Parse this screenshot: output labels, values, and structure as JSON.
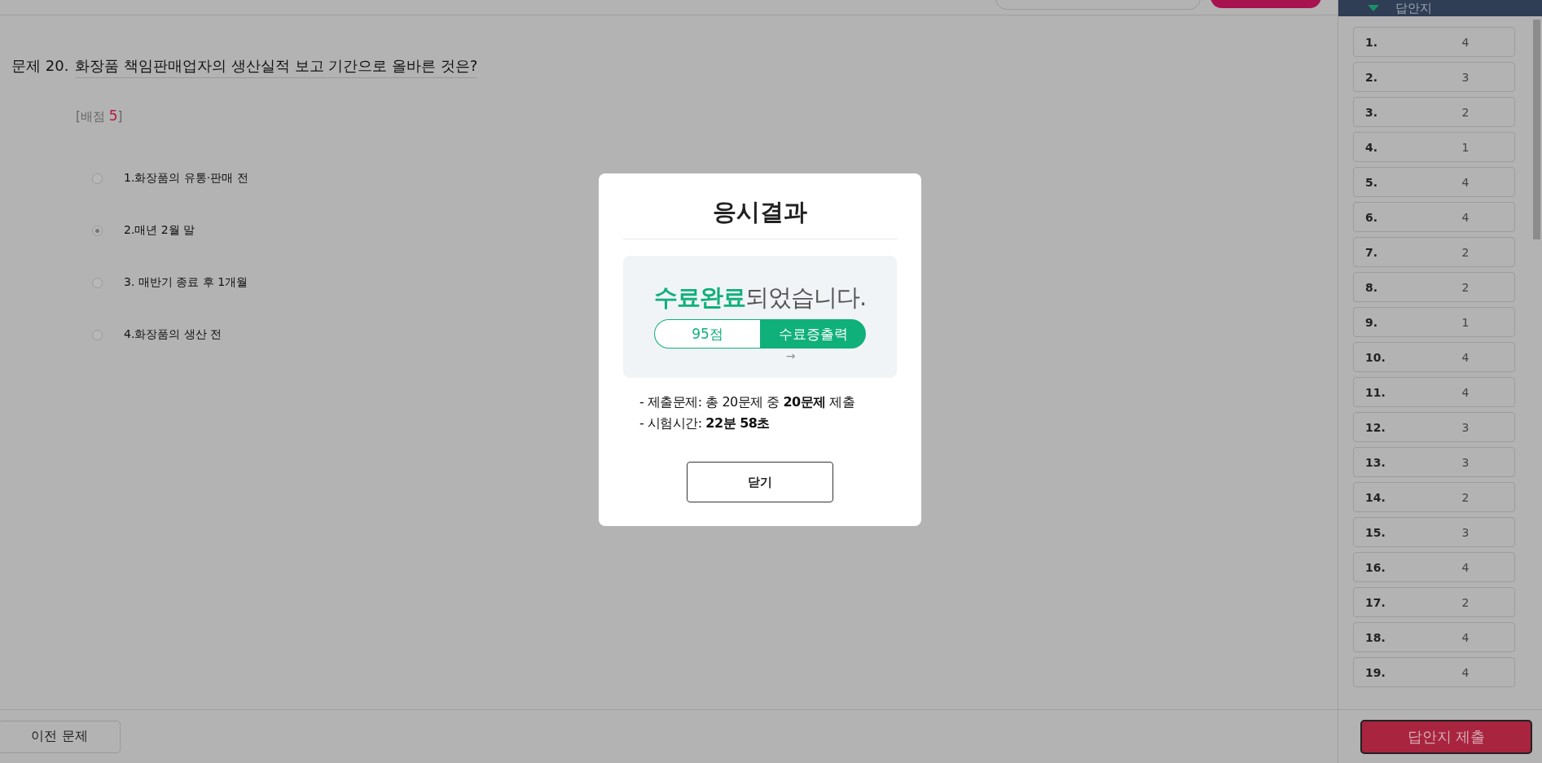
{
  "question": {
    "number": "문제 20.",
    "text": "화장품 책임판매업자의 생산실적 보고 기간으로 올바른 것은?",
    "score_prefix": "[배점",
    "score": "5",
    "score_suffix": "]",
    "options": [
      {
        "label": "1.화장품의 유통·판매 전",
        "selected": false
      },
      {
        "label": "2.매년 2월 말",
        "selected": true
      },
      {
        "label": "3. 매반기 종료 후 1개월",
        "selected": false
      },
      {
        "label": "4.화장품의 생산 전",
        "selected": false
      }
    ]
  },
  "prev_button": "이전 문제",
  "sidebar": {
    "title": "답안지",
    "answers": [
      {
        "number": "1.",
        "answer": "4"
      },
      {
        "number": "2.",
        "answer": "3"
      },
      {
        "number": "3.",
        "answer": "2"
      },
      {
        "number": "4.",
        "answer": "1"
      },
      {
        "number": "5.",
        "answer": "4"
      },
      {
        "number": "6.",
        "answer": "4"
      },
      {
        "number": "7.",
        "answer": "2"
      },
      {
        "number": "8.",
        "answer": "2"
      },
      {
        "number": "9.",
        "answer": "1"
      },
      {
        "number": "10.",
        "answer": "4"
      },
      {
        "number": "11.",
        "answer": "4"
      },
      {
        "number": "12.",
        "answer": "3"
      },
      {
        "number": "13.",
        "answer": "3"
      },
      {
        "number": "14.",
        "answer": "2"
      },
      {
        "number": "15.",
        "answer": "3"
      },
      {
        "number": "16.",
        "answer": "4"
      },
      {
        "number": "17.",
        "answer": "2"
      },
      {
        "number": "18.",
        "answer": "4"
      },
      {
        "number": "19.",
        "answer": "4"
      }
    ],
    "submit_button": "답안지 제출"
  },
  "modal": {
    "title": "응시결과",
    "message_highlight": "수료완료",
    "message_rest": "되었습니다.",
    "score": "95점",
    "certificate_button": "수료증출력",
    "arrow": "→",
    "details": [
      "- 제출문제: 총 20문제 중 **20문제** 제출",
      "- 시험시간: **22분 58초**"
    ],
    "close_button": "닫기"
  }
}
